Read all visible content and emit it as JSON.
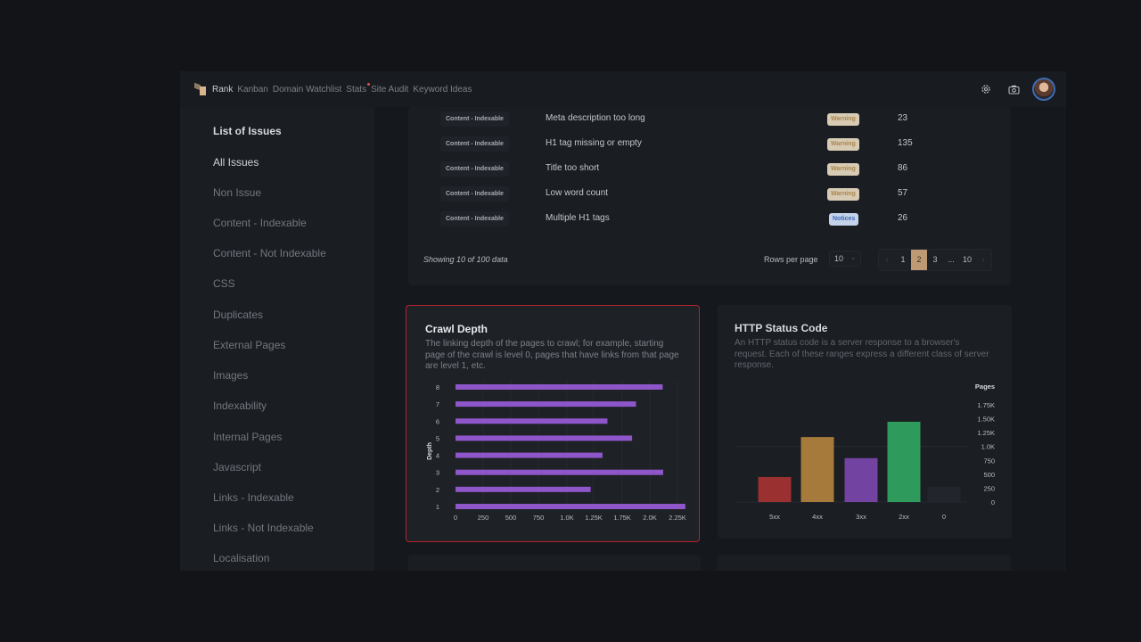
{
  "nav": {
    "items": [
      {
        "label": "Rank",
        "active": true
      },
      {
        "label": "Kanban"
      },
      {
        "label": "Domain Watchlist"
      },
      {
        "label": "Stats",
        "badge_dot": true
      },
      {
        "label": "Site Audit"
      },
      {
        "label": "Keyword Ideas"
      }
    ],
    "icons": [
      "settings-icon",
      "camera-icon",
      "avatar"
    ]
  },
  "sidebar": {
    "title": "List of Issues",
    "items": [
      {
        "label": "All Issues",
        "active": true
      },
      {
        "label": "Non Issue"
      },
      {
        "label": "Content - Indexable"
      },
      {
        "label": "Content - Not Indexable"
      },
      {
        "label": "CSS"
      },
      {
        "label": "Duplicates"
      },
      {
        "label": "External Pages"
      },
      {
        "label": "Images"
      },
      {
        "label": "Indexability"
      },
      {
        "label": "Internal Pages"
      },
      {
        "label": "Javascript"
      },
      {
        "label": "Links - Indexable"
      },
      {
        "label": "Links - Not Indexable"
      },
      {
        "label": "Localisation"
      }
    ]
  },
  "issues_table": {
    "rows": [
      {
        "category": "Content - Indexable",
        "issue": "Meta description too long",
        "severity": "Warning",
        "count": "23"
      },
      {
        "category": "Content - Indexable",
        "issue": "H1 tag missing or empty",
        "severity": "Warning",
        "count": "135"
      },
      {
        "category": "Content - Indexable",
        "issue": "Title too short",
        "severity": "Warning",
        "count": "86"
      },
      {
        "category": "Content - Indexable",
        "issue": "Low word count",
        "severity": "Warning",
        "count": "57"
      },
      {
        "category": "Content - Indexable",
        "issue": "Multiple H1 tags",
        "severity": "Notices",
        "count": "26"
      }
    ],
    "footer": {
      "showing": "Showing 10 of 100 data",
      "rows_per_page_label": "Rows per page",
      "rows_per_page_value": "10",
      "pages": [
        "‹",
        "1",
        "2",
        "3",
        "...",
        "10",
        "›"
      ],
      "current_page": "2"
    }
  },
  "crawl_depth": {
    "title": "Crawl Depth",
    "description": "The linking depth of the pages to crawl; for example, starting page of the crawl is level 0, pages that have links from that page are level 1, etc."
  },
  "http_status": {
    "title": "HTTP Status Code",
    "description": "An HTTP status code is a server response to a browser's request. Each of these ranges express a different class of server response."
  },
  "chart_data": [
    {
      "type": "bar",
      "orientation": "horizontal",
      "title": "Crawl Depth",
      "ylabel": "Depth",
      "xlabel": "",
      "categories": [
        "1",
        "2",
        "3",
        "4",
        "5",
        "6",
        "7",
        "8"
      ],
      "values": [
        2330,
        1370,
        2105,
        1490,
        1790,
        1540,
        1830,
        2100
      ],
      "xlim": [
        0,
        2250
      ],
      "xticks": [
        "0",
        "250",
        "500",
        "750",
        "1.0K",
        "1.25K",
        "1.75K",
        "2.0K",
        "2.25K"
      ],
      "color": "#8e56c9",
      "grid": true
    },
    {
      "type": "bar",
      "orientation": "vertical",
      "title": "HTTP Status Code",
      "ylabel": "Pages",
      "categories": [
        "5xx",
        "4xx",
        "3xx",
        "2xx",
        "0"
      ],
      "values": [
        450,
        1170,
        790,
        1445,
        275
      ],
      "colors": [
        "#9b3030",
        "#a67a3a",
        "#7243a1",
        "#2e9a5c",
        "#22262c"
      ],
      "ylim": [
        0,
        1750
      ],
      "yticks": [
        "0",
        "250",
        "500",
        "750",
        "1.0K",
        "1.25K",
        "1.50K",
        "1.75K"
      ],
      "y_axis_side": "right",
      "grid": true
    }
  ]
}
